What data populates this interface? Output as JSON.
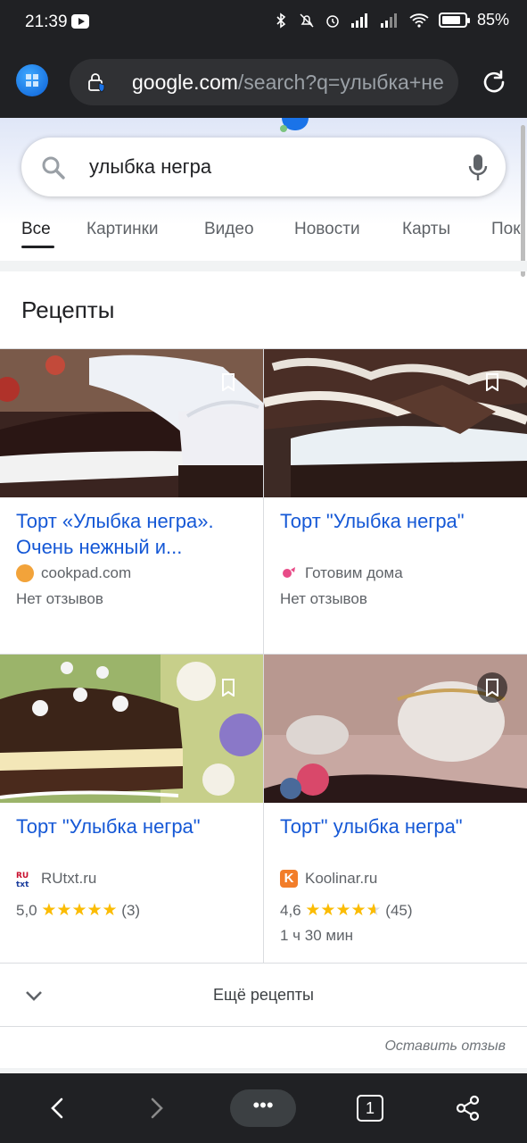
{
  "status_bar": {
    "time": "21:39",
    "battery_percent": "85%",
    "battery_level": 0.85,
    "icons": [
      "youtube-icon",
      "bluetooth-icon",
      "mute-icon",
      "alarm-icon",
      "signal-icon",
      "signal-icon",
      "wifi-icon",
      "battery-icon"
    ]
  },
  "browser": {
    "url_host": "google.com",
    "url_rest": "/search?q=улыбка+не"
  },
  "search": {
    "query": "улыбка негра"
  },
  "tabs": [
    {
      "label": "Все",
      "active": true
    },
    {
      "label": "Картинки",
      "active": false
    },
    {
      "label": "Видео",
      "active": false
    },
    {
      "label": "Новости",
      "active": false
    },
    {
      "label": "Карты",
      "active": false
    },
    {
      "label": "Пок",
      "active": false
    }
  ],
  "recipes": {
    "title": "Рецепты",
    "cards": [
      {
        "title": "Торт «Улыбка негра». Очень нежный и...",
        "source": "cookpad.com",
        "rating_text": "Нет отзывов"
      },
      {
        "title": "Торт \"Улыбка негра\"",
        "source": "Готовим дома",
        "rating_text": "Нет отзывов"
      },
      {
        "title": "Торт \"Улыбка негра\"",
        "source": "RUtxt.ru",
        "rating": "5,0",
        "stars": "★★★★★",
        "reviews": "(3)"
      },
      {
        "title": "Торт\" улыбка негра\"",
        "source": "Koolinar.ru",
        "rating": "4,6",
        "stars": "★★★★",
        "reviews": "(45)",
        "time": "1 ч 30 мин"
      }
    ],
    "more_label": "Ещё рецепты",
    "feedback_label": "Оставить отзыв"
  },
  "bottom_nav": {
    "menu_label": "•••",
    "tab_count": "1"
  },
  "colors": {
    "link_blue": "#1558d6",
    "star_yellow": "#fbbc04",
    "dark_bar": "#202124"
  }
}
